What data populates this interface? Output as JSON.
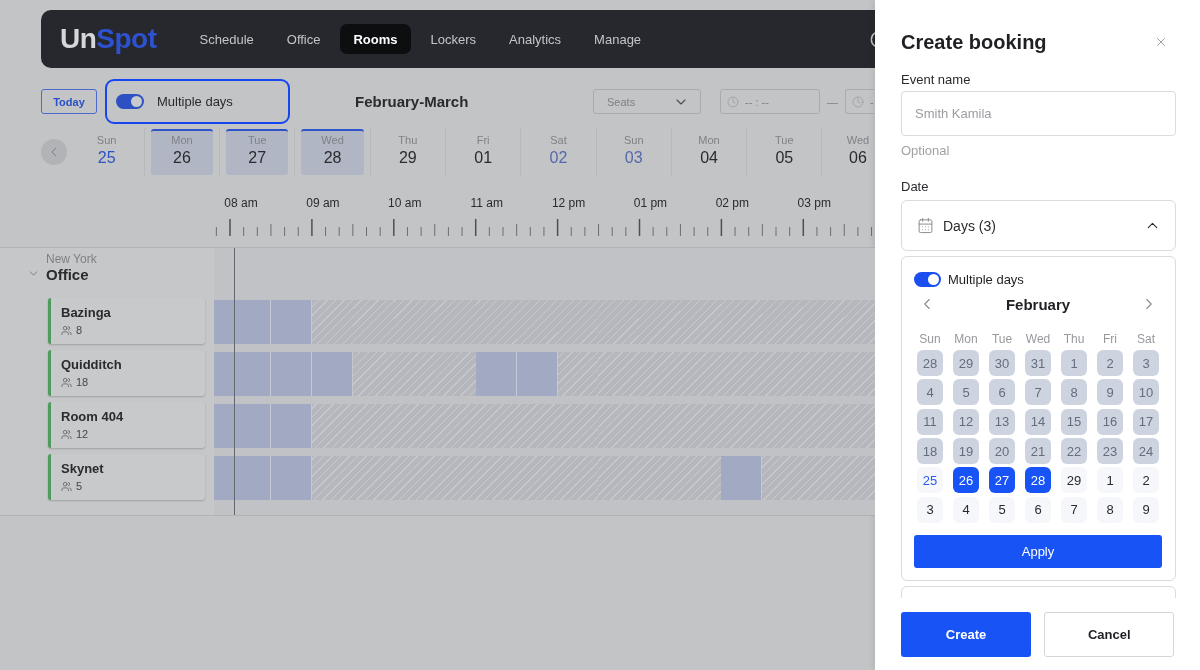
{
  "nav": {
    "logo": [
      "Un",
      "Spot"
    ],
    "items": [
      {
        "label": "Schedule",
        "selected": false
      },
      {
        "label": "Office",
        "selected": false
      },
      {
        "label": "Rooms",
        "selected": true
      },
      {
        "label": "Lockers",
        "selected": false
      },
      {
        "label": "Analytics",
        "selected": false
      },
      {
        "label": "Manage",
        "selected": false
      }
    ]
  },
  "toolbar": {
    "today_button": "Today",
    "multiple_days": {
      "label": "Multiple days",
      "on": true,
      "highlighted": true
    },
    "period_title": "February-March",
    "seats": {
      "placeholder": "Seats"
    },
    "time_from": {
      "placeholder": "-- : --"
    },
    "time_separator": "—",
    "time_to": {
      "placeholder": "-"
    }
  },
  "date_strip": [
    {
      "weekday": "Sun",
      "date": "25",
      "selected": false,
      "today": true,
      "weekend": false
    },
    {
      "weekday": "Mon",
      "date": "26",
      "selected": true,
      "today": false,
      "weekend": false
    },
    {
      "weekday": "Tue",
      "date": "27",
      "selected": true,
      "today": false,
      "weekend": false
    },
    {
      "weekday": "Wed",
      "date": "28",
      "selected": true,
      "today": false,
      "weekend": false
    },
    {
      "weekday": "Thu",
      "date": "29",
      "selected": false,
      "today": false,
      "weekend": false
    },
    {
      "weekday": "Fri",
      "date": "01",
      "selected": false,
      "today": false,
      "weekend": false
    },
    {
      "weekday": "Sat",
      "date": "02",
      "selected": false,
      "today": false,
      "weekend": true
    },
    {
      "weekday": "Sun",
      "date": "03",
      "selected": false,
      "today": false,
      "weekend": true
    },
    {
      "weekday": "Mon",
      "date": "04",
      "selected": false,
      "today": false,
      "weekend": false
    },
    {
      "weekday": "Tue",
      "date": "05",
      "selected": false,
      "today": false,
      "weekend": false
    },
    {
      "weekday": "Wed",
      "date": "06",
      "selected": false,
      "today": false,
      "weekend": false
    }
  ],
  "timeline": {
    "hours": [
      "08 am",
      "09 am",
      "10 am",
      "11 am",
      "12 pm",
      "01 pm",
      "02 pm",
      "03 pm"
    ],
    "now_line": true
  },
  "locations": [
    {
      "city": "New York",
      "name": "Office",
      "expanded": true,
      "rooms": [
        {
          "name": "Bazinga",
          "capacity": "8",
          "slots": [
            {
              "kind": "block"
            },
            {
              "kind": "block"
            },
            {
              "kind": "hatched"
            },
            {
              "kind": "hatched"
            },
            {
              "kind": "hatched"
            },
            {
              "kind": "hatched"
            },
            {
              "kind": "hatched"
            },
            {
              "kind": "hatched"
            },
            {
              "kind": "hatched"
            },
            {
              "kind": "hatched"
            },
            {
              "kind": "hatched"
            },
            {
              "kind": "hatched"
            },
            {
              "kind": "hatched"
            },
            {
              "kind": "hatched"
            },
            {
              "kind": "hatched"
            },
            {
              "kind": "hatched"
            }
          ]
        },
        {
          "name": "Quidditch",
          "capacity": "18",
          "slots": [
            {
              "kind": "block"
            },
            {
              "kind": "block"
            },
            {
              "kind": "block"
            },
            {
              "kind": "hatched"
            },
            {
              "kind": "hatched"
            },
            {
              "kind": "hatched"
            },
            {
              "kind": "block"
            },
            {
              "kind": "block"
            },
            {
              "kind": "hatched"
            },
            {
              "kind": "hatched"
            },
            {
              "kind": "hatched"
            },
            {
              "kind": "hatched"
            },
            {
              "kind": "hatched"
            },
            {
              "kind": "hatched"
            },
            {
              "kind": "hatched"
            },
            {
              "kind": "hatched"
            }
          ]
        },
        {
          "name": "Room 404",
          "capacity": "12",
          "slots": [
            {
              "kind": "block"
            },
            {
              "kind": "block"
            },
            {
              "kind": "hatched"
            },
            {
              "kind": "hatched"
            },
            {
              "kind": "hatched"
            },
            {
              "kind": "hatched"
            },
            {
              "kind": "hatched"
            },
            {
              "kind": "hatched"
            },
            {
              "kind": "hatched"
            },
            {
              "kind": "hatched"
            },
            {
              "kind": "hatched"
            },
            {
              "kind": "hatched"
            },
            {
              "kind": "hatched"
            },
            {
              "kind": "hatched"
            },
            {
              "kind": "hatched"
            },
            {
              "kind": "hatched"
            }
          ]
        },
        {
          "name": "Skynet",
          "capacity": "5",
          "slots": [
            {
              "kind": "block"
            },
            {
              "kind": "block"
            },
            {
              "kind": "hatched"
            },
            {
              "kind": "hatched"
            },
            {
              "kind": "hatched"
            },
            {
              "kind": "hatched"
            },
            {
              "kind": "hatched"
            },
            {
              "kind": "hatched"
            },
            {
              "kind": "hatched"
            },
            {
              "kind": "hatched"
            },
            {
              "kind": "hatched"
            },
            {
              "kind": "hatched"
            },
            {
              "kind": "block"
            },
            {
              "kind": "hatched"
            },
            {
              "kind": "hatched"
            },
            {
              "kind": "hatched"
            }
          ]
        }
      ]
    }
  ],
  "panel": {
    "title": "Create booking",
    "event_name": {
      "label": "Event name",
      "placeholder": "Smith Kamila",
      "hint": "Optional"
    },
    "date": {
      "label": "Date",
      "value": "Days (3)",
      "expanded": true,
      "picker": {
        "multiple_days": {
          "label": "Multiple days",
          "on": true
        },
        "month": "February",
        "weekdays": [
          "Sun",
          "Mon",
          "Tue",
          "Wed",
          "Thu",
          "Fri",
          "Sat"
        ],
        "days": [
          {
            "day": "28",
            "disabled": true,
            "selected": false,
            "today": false
          },
          {
            "day": "29",
            "disabled": true,
            "selected": false,
            "today": false
          },
          {
            "day": "30",
            "disabled": true,
            "selected": false,
            "today": false
          },
          {
            "day": "31",
            "disabled": true,
            "selected": false,
            "today": false
          },
          {
            "day": "1",
            "disabled": true,
            "selected": false,
            "today": false
          },
          {
            "day": "2",
            "disabled": true,
            "selected": false,
            "today": false
          },
          {
            "day": "3",
            "disabled": true,
            "selected": false,
            "today": false
          },
          {
            "day": "4",
            "disabled": true,
            "selected": false,
            "today": false
          },
          {
            "day": "5",
            "disabled": true,
            "selected": false,
            "today": false
          },
          {
            "day": "6",
            "disabled": true,
            "selected": false,
            "today": false
          },
          {
            "day": "7",
            "disabled": true,
            "selected": false,
            "today": false
          },
          {
            "day": "8",
            "disabled": true,
            "selected": false,
            "today": false
          },
          {
            "day": "9",
            "disabled": true,
            "selected": false,
            "today": false
          },
          {
            "day": "10",
            "disabled": true,
            "selected": false,
            "today": false
          },
          {
            "day": "11",
            "disabled": true,
            "selected": false,
            "today": false
          },
          {
            "day": "12",
            "disabled": true,
            "selected": false,
            "today": false
          },
          {
            "day": "13",
            "disabled": true,
            "selected": false,
            "today": false
          },
          {
            "day": "14",
            "disabled": true,
            "selected": false,
            "today": false
          },
          {
            "day": "15",
            "disabled": true,
            "selected": false,
            "today": false
          },
          {
            "day": "16",
            "disabled": true,
            "selected": false,
            "today": false
          },
          {
            "day": "17",
            "disabled": true,
            "selected": false,
            "today": false
          },
          {
            "day": "18",
            "disabled": true,
            "selected": false,
            "today": false
          },
          {
            "day": "19",
            "disabled": true,
            "selected": false,
            "today": false
          },
          {
            "day": "20",
            "disabled": true,
            "selected": false,
            "today": false
          },
          {
            "day": "21",
            "disabled": true,
            "selected": false,
            "today": false
          },
          {
            "day": "22",
            "disabled": true,
            "selected": false,
            "today": false
          },
          {
            "day": "23",
            "disabled": true,
            "selected": false,
            "today": false
          },
          {
            "day": "24",
            "disabled": true,
            "selected": false,
            "today": false
          },
          {
            "day": "25",
            "disabled": false,
            "selected": false,
            "today": true
          },
          {
            "day": "26",
            "disabled": false,
            "selected": true,
            "today": false
          },
          {
            "day": "27",
            "disabled": false,
            "selected": true,
            "today": false
          },
          {
            "day": "28",
            "disabled": false,
            "selected": true,
            "today": false
          },
          {
            "day": "29",
            "disabled": false,
            "selected": false,
            "today": false
          },
          {
            "day": "1",
            "disabled": false,
            "selected": false,
            "today": false
          },
          {
            "day": "2",
            "disabled": false,
            "selected": false,
            "today": false
          },
          {
            "day": "3",
            "disabled": false,
            "selected": false,
            "today": false
          },
          {
            "day": "4",
            "disabled": false,
            "selected": false,
            "today": false
          },
          {
            "day": "5",
            "disabled": false,
            "selected": false,
            "today": false
          },
          {
            "day": "6",
            "disabled": false,
            "selected": false,
            "today": false
          },
          {
            "day": "7",
            "disabled": false,
            "selected": false,
            "today": false
          },
          {
            "day": "8",
            "disabled": false,
            "selected": false,
            "today": false
          },
          {
            "day": "9",
            "disabled": false,
            "selected": false,
            "today": false
          }
        ],
        "apply": "Apply"
      }
    },
    "actions": [
      {
        "label": "Create",
        "kind": "primary"
      },
      {
        "label": "Cancel",
        "kind": "secondary"
      }
    ]
  }
}
